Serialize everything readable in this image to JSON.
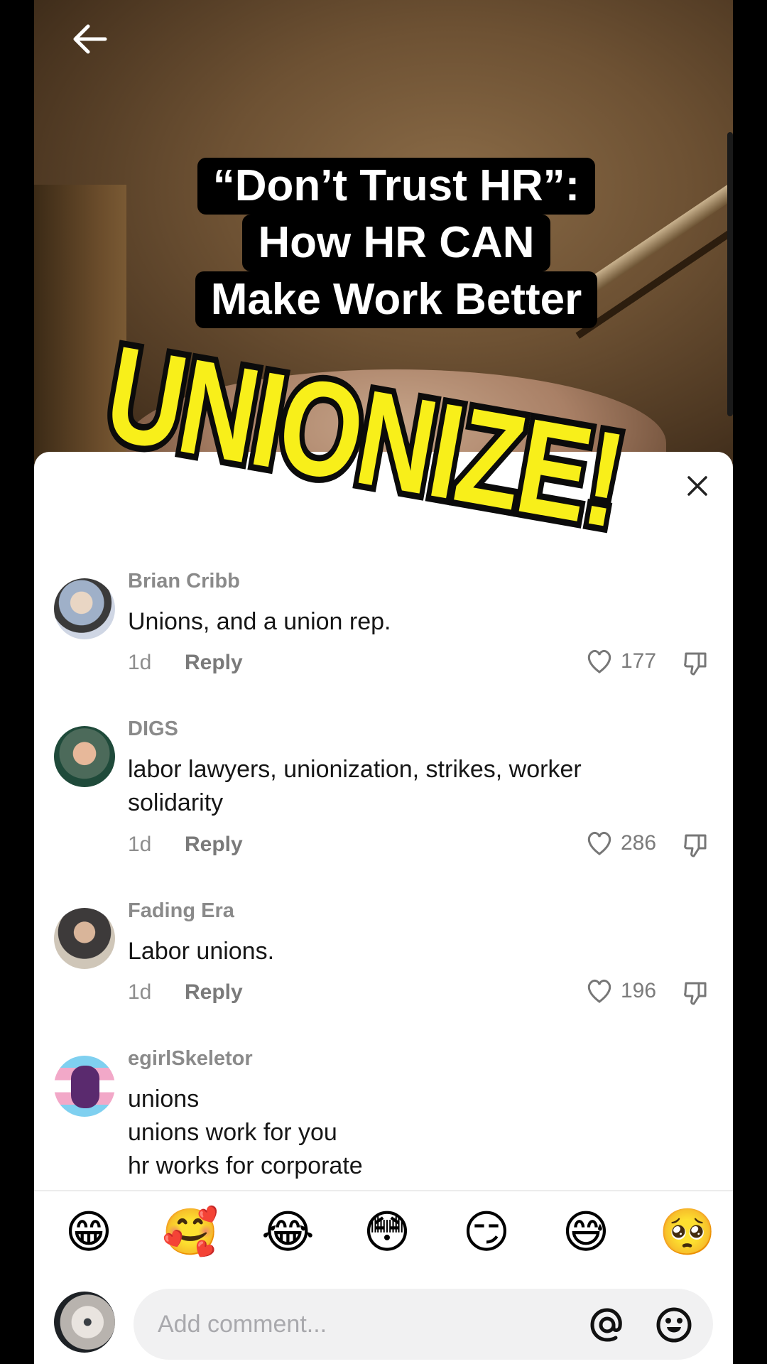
{
  "video": {
    "caption_lines": [
      "“Don’t Trust HR”:",
      "How HR CAN",
      "Make Work Better"
    ],
    "sticker_text": "UNIONIZE!"
  },
  "comments": [
    {
      "username": "Brian Cribb",
      "text": "Unions, and a union rep.",
      "time": "1d",
      "reply": "Reply",
      "likes": "177"
    },
    {
      "username": "DIGS",
      "text": "labor lawyers, unionization, strikes, worker solidarity",
      "time": "1d",
      "reply": "Reply",
      "likes": "286"
    },
    {
      "username": "Fading  Era",
      "text": "Labor unions.",
      "time": "1d",
      "reply": "Reply",
      "likes": "196"
    },
    {
      "username": "egirlSkeletor",
      "text_lines": [
        "unions",
        "unions work for you",
        "hr works for corporate"
      ]
    }
  ],
  "emojis": [
    "😁",
    "🥰",
    "😂",
    "😳",
    "😏",
    "😅",
    "🥺"
  ],
  "composer": {
    "placeholder": "Add comment..."
  },
  "colors": {
    "sticker_yellow": "#f8ef1a",
    "caption_bg": "#000000",
    "input_bg": "#f1f1f2"
  }
}
